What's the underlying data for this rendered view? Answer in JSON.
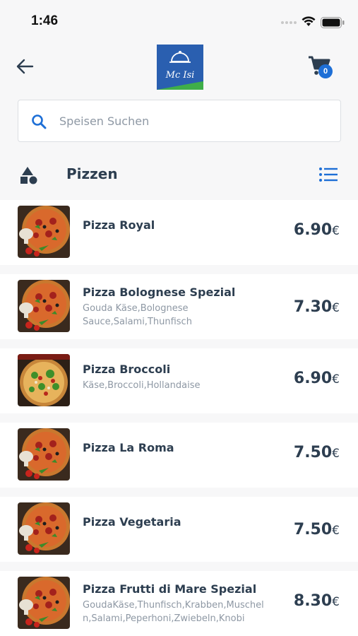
{
  "status_bar": {
    "time": "1:46"
  },
  "header": {
    "logo_text": "Mc Isi",
    "cart_count": "0"
  },
  "search": {
    "placeholder": "Speisen Suchen"
  },
  "category": {
    "title": "Pizzen"
  },
  "currency_symbol": "€",
  "colors": {
    "accent": "#1e6fd6",
    "text": "#2d3e50",
    "muted": "#8e98a4",
    "logo_blue": "#2a5fb0",
    "logo_green": "#3fae49"
  },
  "products": [
    {
      "name": "Pizza Royal",
      "description": "",
      "price": "6.90"
    },
    {
      "name": "Pizza Bolognese Spezial",
      "description_lines": [
        "Gouda Käse,Bolognese",
        "Sauce,Salami,Thunfisch"
      ],
      "price": "7.30"
    },
    {
      "name": "Pizza Broccoli",
      "description_lines": [
        "Käse,Broccoli,Hollandaise"
      ],
      "price": "6.90"
    },
    {
      "name": "Pizza La Roma",
      "description": "",
      "price": "7.50"
    },
    {
      "name": "Pizza Vegetaria",
      "description": "",
      "price": "7.50"
    },
    {
      "name": "Pizza Frutti di Mare Spezial",
      "description_lines": [
        "GoudaKäse,Thunfisch,Krabben,Muschel",
        "n,Salami,Peperhoni,Zwiebeln,Knobi"
      ],
      "price": "8.30"
    }
  ]
}
